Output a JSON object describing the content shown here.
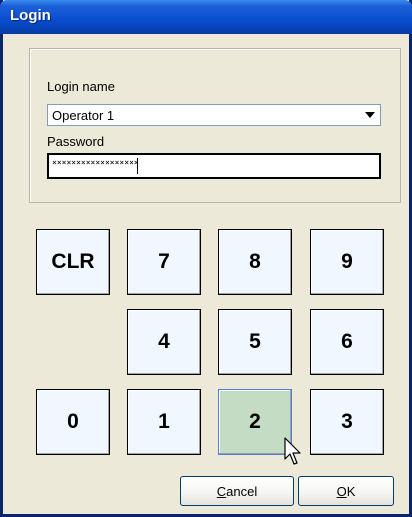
{
  "window": {
    "title": "Login"
  },
  "login_name": {
    "label": "Login name",
    "value": "Operator 1"
  },
  "password": {
    "label": "Password",
    "value": "××××××××××××××××××"
  },
  "keypad": {
    "keys": [
      "CLR",
      "7",
      "8",
      "9",
      "4",
      "5",
      "6",
      "0",
      "1",
      "2",
      "3"
    ]
  },
  "buttons": {
    "cancel": {
      "hotkey": "C",
      "rest": "ancel"
    },
    "ok": {
      "hotkey": "O",
      "rest": "K"
    }
  },
  "colors": {
    "titlebar": "#0a4fd0",
    "key_face": "#f0f7ff",
    "key_hover": "#c5dcc4"
  }
}
